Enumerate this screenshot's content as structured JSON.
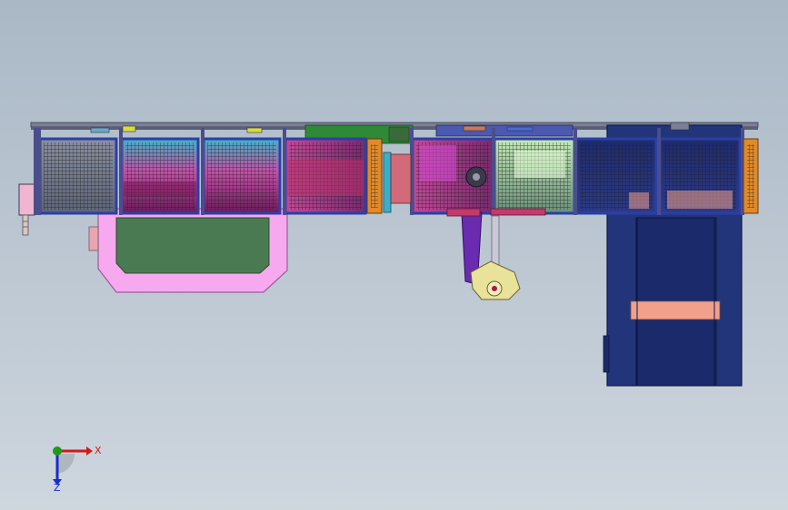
{
  "viewport": {
    "background_top": "#aab8c6",
    "background_bottom": "#ced6de"
  },
  "model": {
    "description_icon": "cad-assembly-front-view",
    "colors": {
      "rail": "#6a6f86",
      "frame_blue": "#2b3fa8",
      "frame_dark": "#1c2a66",
      "mesh": "#2a2a2a",
      "pink": "#f6a9ee",
      "green_panel": "#4a7a52",
      "navy": "#1f3173",
      "salmon": "#f2a08c",
      "purple": "#6a2bb0",
      "yellow": "#e8e29a",
      "orange": "#e08a2a",
      "teal": "#3ab0c8",
      "magenta": "#c4309a"
    }
  },
  "triad": {
    "x_label": "X",
    "z_label": "Z",
    "x_color": "#d11a1a",
    "y_color": "#1a9b1a",
    "z_color": "#1a2ad1"
  }
}
